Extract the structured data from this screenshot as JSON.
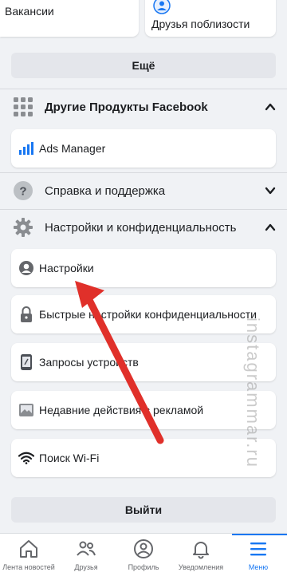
{
  "top_cards": {
    "jobs_label": "Вакансии",
    "nearby_friends_label": "Друзья поблизости"
  },
  "more_button": "Ещё",
  "sections": {
    "other_products": {
      "title": "Другие Продукты Facebook"
    },
    "help": {
      "title": "Справка и поддержка"
    },
    "settings_privacy": {
      "title": "Настройки и конфиденциальность"
    }
  },
  "other_products_items": [
    {
      "label": "Ads Manager",
      "icon": "ads-manager-icon"
    }
  ],
  "settings_items": [
    {
      "label": "Настройки",
      "icon": "profile-settings-icon"
    },
    {
      "label": "Быстрые настройки конфиденциальности",
      "icon": "lock-icon"
    },
    {
      "label": "Запросы устройств",
      "icon": "device-icon"
    },
    {
      "label": "Недавние действия с рекламой",
      "icon": "ad-activity-icon"
    },
    {
      "label": "Поиск Wi-Fi",
      "icon": "wifi-icon"
    }
  ],
  "logout_button": "Выйти",
  "tabs": [
    {
      "label": "Лента новостей",
      "icon": "home-icon"
    },
    {
      "label": "Друзья",
      "icon": "friends-icon"
    },
    {
      "label": "Профиль",
      "icon": "profile-icon"
    },
    {
      "label": "Уведомления",
      "icon": "bell-icon"
    },
    {
      "label": "Меню",
      "icon": "menu-icon"
    }
  ],
  "watermark": "instagrammar.ru",
  "colors": {
    "background": "#f0f2f5",
    "accent": "#1877f2",
    "arrow": "#e0302a"
  }
}
